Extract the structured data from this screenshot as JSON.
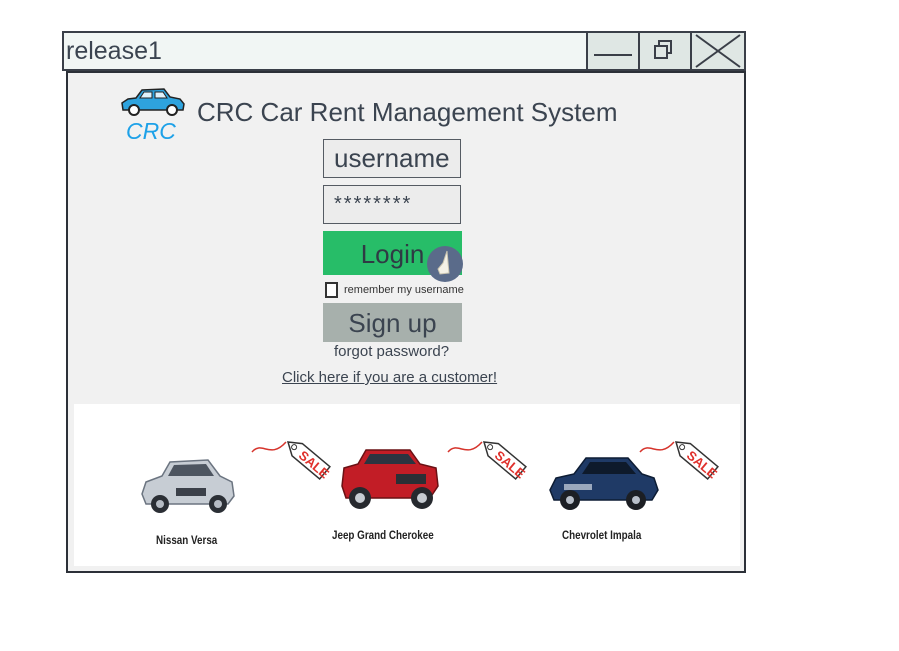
{
  "window": {
    "title": "release1",
    "minimize_label": "",
    "restore_label": "",
    "close_label": ""
  },
  "header": {
    "logo_text": "CRC",
    "app_title": "CRC Car Rent Management System"
  },
  "login": {
    "username_value": "username",
    "password_value": "********",
    "login_label": "Login",
    "remember_label": "remember my username",
    "remember_checked": false,
    "signup_label": "Sign up",
    "forgot_label": "forgot password?",
    "customer_link": "Click here if you are a customer!"
  },
  "banner": {
    "tag_text": "SALE",
    "cars": [
      {
        "name": "Nissan Versa",
        "color": "#c7cdd4"
      },
      {
        "name": "Jeep Grand Cherokee",
        "color": "#c21d26"
      },
      {
        "name": "Chevrolet Impala",
        "color": "#1f3a66"
      }
    ]
  },
  "colors": {
    "login_button": "#27bd68",
    "signup_button": "#a7b0ac",
    "logo_text": "#1da1e8",
    "sale_text": "#e0302b"
  }
}
